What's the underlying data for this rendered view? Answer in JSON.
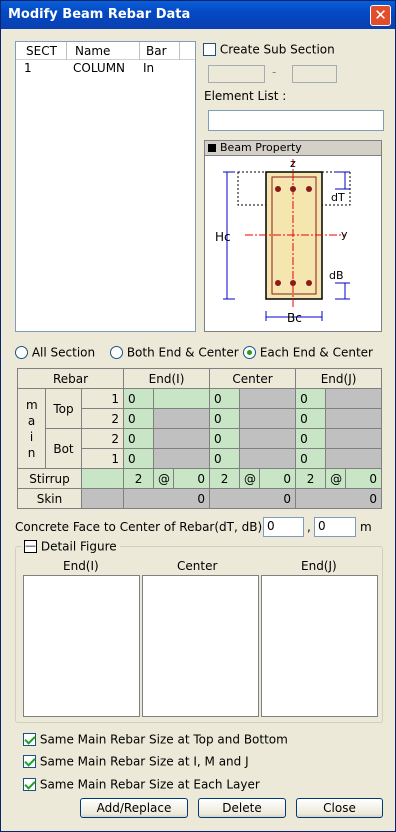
{
  "window": {
    "title": "Modify Beam Rebar Data"
  },
  "section_list": {
    "headers": [
      "SECT",
      "Name",
      "Bar"
    ],
    "rows": [
      {
        "sect": "1",
        "name": "COLUMN",
        "bar": "In"
      }
    ]
  },
  "sub_section": {
    "label": "Create Sub Section",
    "checked": false,
    "from": "",
    "dash": "-",
    "to": ""
  },
  "element_list": {
    "label": "Element List :",
    "value": ""
  },
  "beam_property": {
    "title": "Beam Property",
    "labels": {
      "z": "z",
      "y": "y",
      "hc": "Hc",
      "bc": "Bc",
      "dt": "dT",
      "db": "dB"
    }
  },
  "section_mode": {
    "options": [
      "All Section",
      "Both End & Center",
      "Each End & Center"
    ],
    "selected": 2
  },
  "rebar_table": {
    "headers": {
      "rebar": "Rebar",
      "end_i": "End(I)",
      "center": "Center",
      "end_j": "End(J)"
    },
    "main_label": "m a i n",
    "top_label": "Top",
    "bot_label": "Bot",
    "layers": [
      "1",
      "2",
      "2",
      "1"
    ],
    "main_values": [
      {
        "end_i": "0",
        "center": "0",
        "end_j": "0"
      },
      {
        "end_i": "0",
        "center": "0",
        "end_j": "0"
      },
      {
        "end_i": "0",
        "center": "0",
        "end_j": "0"
      },
      {
        "end_i": "0",
        "center": "0",
        "end_j": "0"
      }
    ],
    "stirrup": {
      "label": "Stirrup",
      "at": "@",
      "end_i": [
        "2",
        "0"
      ],
      "center": [
        "2",
        "0"
      ],
      "end_j": [
        "2",
        "0"
      ]
    },
    "skin": {
      "label": "Skin",
      "end_i": "0",
      "center": "0",
      "end_j": "0"
    }
  },
  "concrete_face": {
    "label": "Concrete Face to Center of Rebar(dT, dB):",
    "dt": "0",
    "sep": ",",
    "db": "0",
    "unit": "m"
  },
  "detail_figure": {
    "title": "Detail Figure",
    "toggle": "—",
    "columns": [
      "End(I)",
      "Center",
      "End(J)"
    ]
  },
  "options": [
    {
      "label": "Same Main Rebar Size at Top and Bottom",
      "checked": true
    },
    {
      "label": "Same Main Rebar Size at I, M and J",
      "checked": true
    },
    {
      "label": "Same Main Rebar Size at Each Layer",
      "checked": true
    }
  ],
  "buttons": {
    "add_replace": "Add/Replace",
    "delete": "Delete",
    "close": "Close"
  },
  "colors": {
    "titlebar": "#0a5fd8",
    "editable_cell": "#c8e6c6",
    "disabled_cell": "#c0c0c0",
    "rebar_dot": "#8b1a1a",
    "section_fill": "#f5e6b0"
  }
}
